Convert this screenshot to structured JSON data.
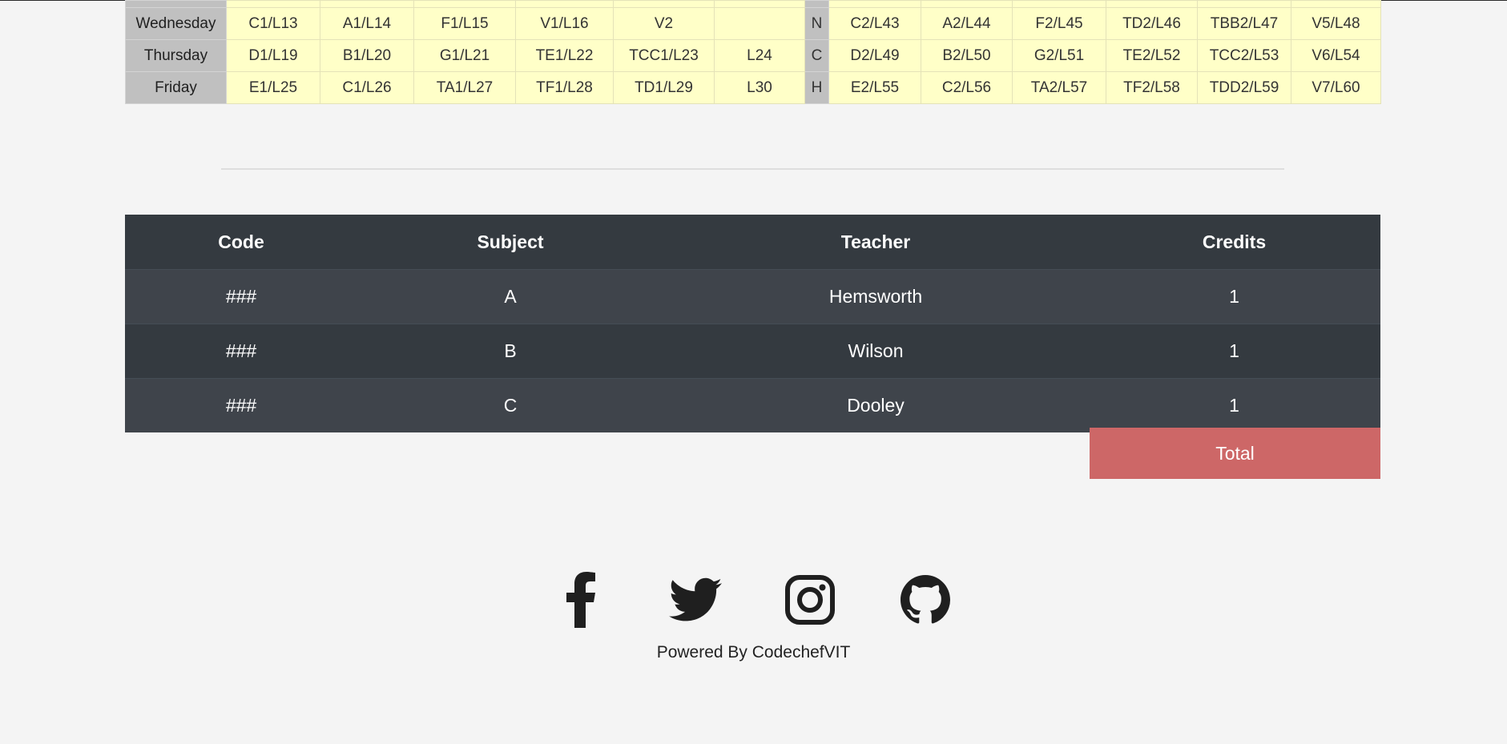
{
  "timetable": {
    "lunch_letters": [
      "",
      "N",
      "C",
      "H"
    ],
    "rows": [
      {
        "day": "",
        "cells": [
          "",
          "",
          "",
          "",
          "",
          ""
        ],
        "cells2": [
          "",
          "",
          "",
          "",
          "",
          ""
        ]
      },
      {
        "day": "Wednesday",
        "cells": [
          "C1/L13",
          "A1/L14",
          "F1/L15",
          "V1/L16",
          "V2",
          ""
        ],
        "cells2": [
          "C2/L43",
          "A2/L44",
          "F2/L45",
          "TD2/L46",
          "TBB2/L47",
          "V5/L48"
        ]
      },
      {
        "day": "Thursday",
        "cells": [
          "D1/L19",
          "B1/L20",
          "G1/L21",
          "TE1/L22",
          "TCC1/L23",
          "L24"
        ],
        "cells2": [
          "D2/L49",
          "B2/L50",
          "G2/L51",
          "TE2/L52",
          "TCC2/L53",
          "V6/L54"
        ]
      },
      {
        "day": "Friday",
        "cells": [
          "E1/L25",
          "C1/L26",
          "TA1/L27",
          "TF1/L28",
          "TD1/L29",
          "L30"
        ],
        "cells2": [
          "E2/L55",
          "C2/L56",
          "TA2/L57",
          "TF2/L58",
          "TDD2/L59",
          "V7/L60"
        ]
      }
    ]
  },
  "courses": {
    "headers": [
      "Code",
      "Subject",
      "Teacher",
      "Credits"
    ],
    "rows": [
      [
        "###",
        "A",
        "Hemsworth",
        "1"
      ],
      [
        "###",
        "B",
        "Wilson",
        "1"
      ],
      [
        "###",
        "C",
        "Dooley",
        "1"
      ]
    ],
    "total_label": "Total"
  },
  "footer": {
    "social_icons": [
      "facebook-icon",
      "twitter-icon",
      "instagram-icon",
      "github-icon"
    ],
    "powered_by": "Powered By CodechefVIT"
  },
  "colors": {
    "table_dark": "#343a40",
    "table_stripe": "#3f444b",
    "total_accent": "#cd6767",
    "slot_yellow": "#ffffc8",
    "day_grey": "#c0c0c0"
  }
}
